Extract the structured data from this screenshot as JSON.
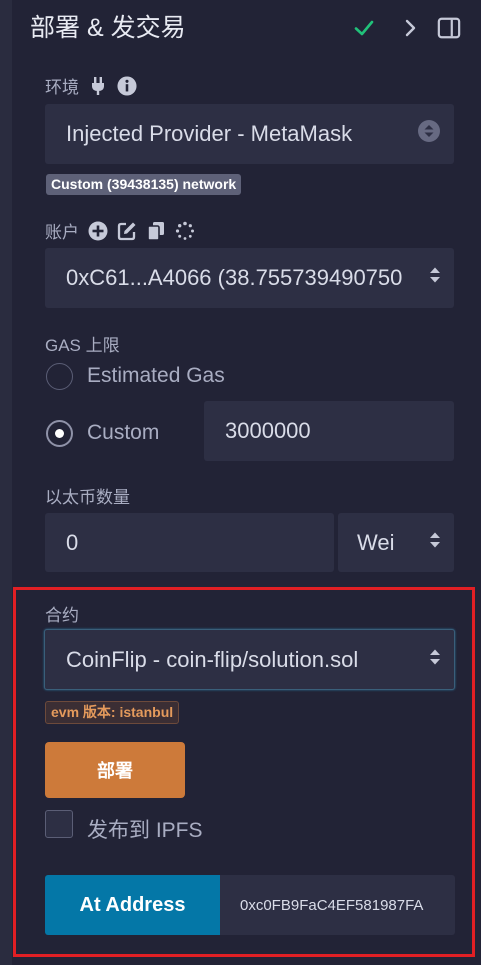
{
  "header": {
    "title": "部署 & 发交易",
    "check_icon": "check-icon",
    "chevron_icon": "chevron-right-icon",
    "panel_icon": "panel-icon"
  },
  "environment": {
    "label": "环境",
    "value": "Injected Provider - MetaMask",
    "network_badge": "Custom (39438135) network"
  },
  "account": {
    "label": "账户",
    "value": "0xC61...A4066 (38.755739490750"
  },
  "gas": {
    "label": "GAS 上限",
    "options": [
      {
        "label": "Estimated Gas",
        "selected": false
      },
      {
        "label": "Custom",
        "selected": true
      }
    ],
    "custom_value": "3000000"
  },
  "value_section": {
    "label": "以太币数量",
    "amount": "0",
    "unit": "Wei"
  },
  "contract": {
    "label": "合约",
    "selected": "CoinFlip - coin-flip/solution.sol",
    "evm_badge": "evm 版本: istanbul",
    "deploy_label": "部署",
    "publish_ipfs_label": "发布到 IPFS",
    "publish_ipfs_checked": false,
    "at_address_label": "At Address",
    "at_address_value": "0xc0FB9FaC4EF581987FA"
  },
  "colors": {
    "background": "#222336",
    "field": "#2d2f44",
    "deploy_button": "#cd7a3a",
    "at_address_button": "#0477a7",
    "highlight_border": "#e11f24",
    "check": "#21c17a"
  }
}
